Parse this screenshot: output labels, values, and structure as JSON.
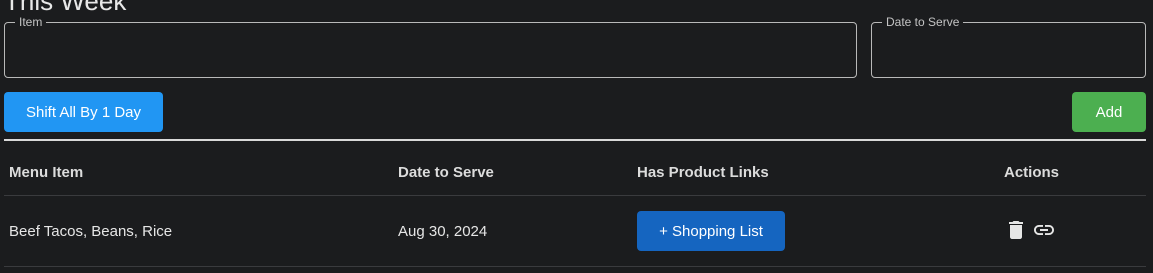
{
  "page": {
    "title": "This Week"
  },
  "form": {
    "item_label": "Item",
    "item_value": "",
    "date_label": "Date to Serve",
    "date_value": ""
  },
  "actions": {
    "shift_label": "Shift All By 1 Day",
    "add_label": "Add"
  },
  "table": {
    "headers": [
      "Menu Item",
      "Date to Serve",
      "Has Product Links",
      "Actions"
    ],
    "rows": [
      {
        "menu_item": "Beef Tacos, Beans, Rice",
        "date_to_serve": "Aug 30, 2024",
        "product_links_button": "+ Shopping List",
        "action_icons": [
          "trash-icon",
          "link-icon"
        ]
      }
    ]
  },
  "colors": {
    "background": "#1b1c1e",
    "shift_button": "#2196f3",
    "add_button": "#4caf50",
    "shopping_button": "#1565c0"
  }
}
